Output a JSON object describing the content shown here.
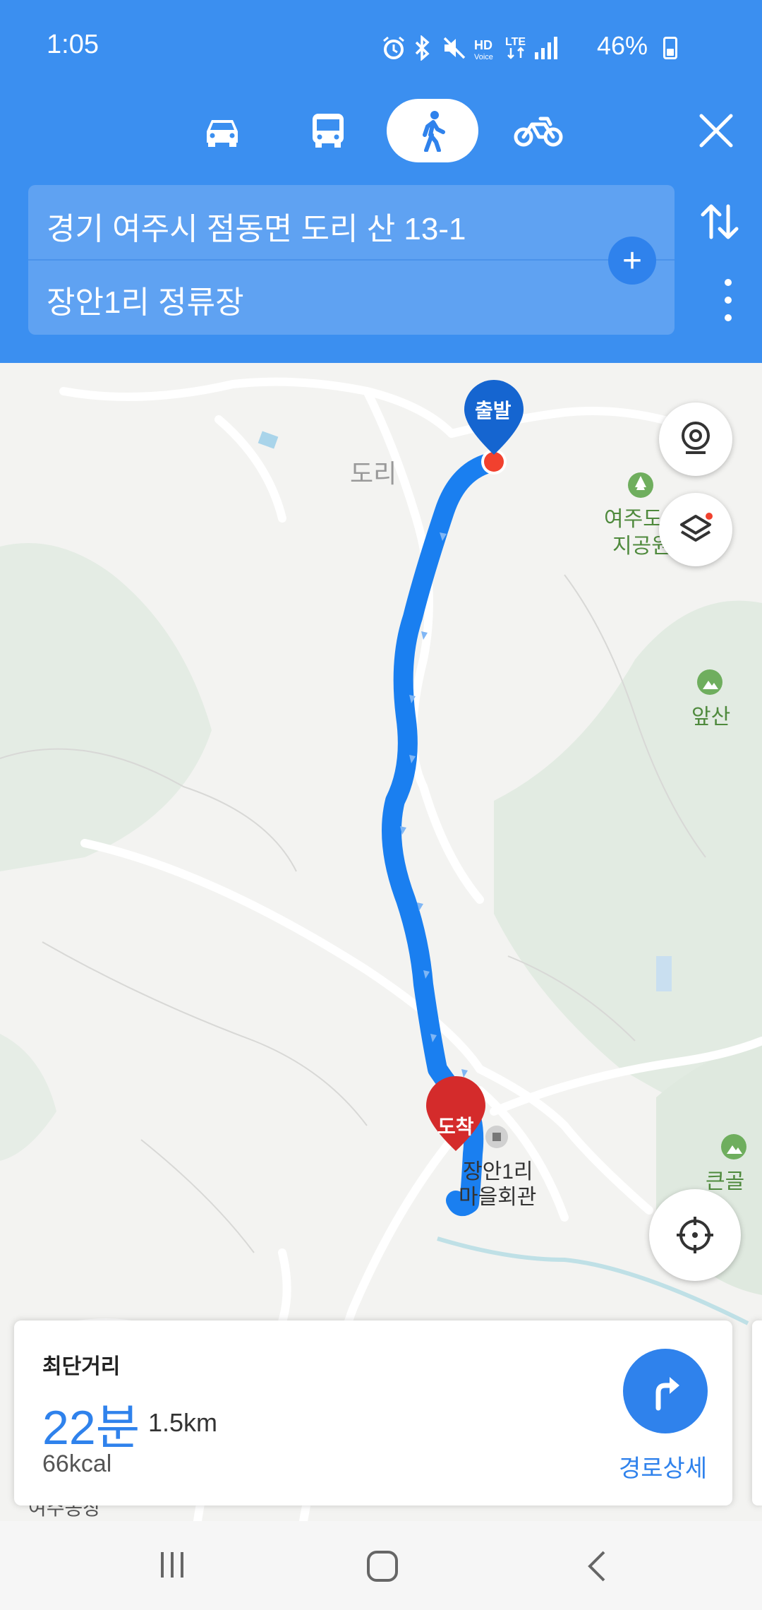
{
  "status_bar": {
    "time": "1:05",
    "battery_percent": "46%"
  },
  "modes": [
    {
      "name": "car",
      "icon": "car-icon",
      "active": false
    },
    {
      "name": "transit",
      "icon": "bus-icon",
      "active": false
    },
    {
      "name": "walk",
      "icon": "walk-icon",
      "active": true
    },
    {
      "name": "bike",
      "icon": "bike-icon",
      "active": false
    }
  ],
  "route": {
    "origin": "경기 여주시 점동면 도리 산 13-1",
    "destination": "장안1리 정류장"
  },
  "map": {
    "start_pin": "출발",
    "end_pin": "도착",
    "labels": {
      "dori": "도리",
      "park_line1": "여주도",
      "park_line2": "지공원",
      "apsan": "앞산",
      "village_line1": "장안1리",
      "village_line2": "마을회관",
      "keungolsan": "큰골산",
      "bottom_cut": "여주농장"
    }
  },
  "result": {
    "title": "최단거리",
    "duration": "22분",
    "distance": "1.5km",
    "calories": "66kcal",
    "detail_label": "경로상세"
  },
  "colors": {
    "header": "#3b8ff0",
    "accent": "#2f82ec",
    "route": "#1a7ff0",
    "end_pin": "#d42b2b",
    "start_pin": "#1565d0"
  }
}
